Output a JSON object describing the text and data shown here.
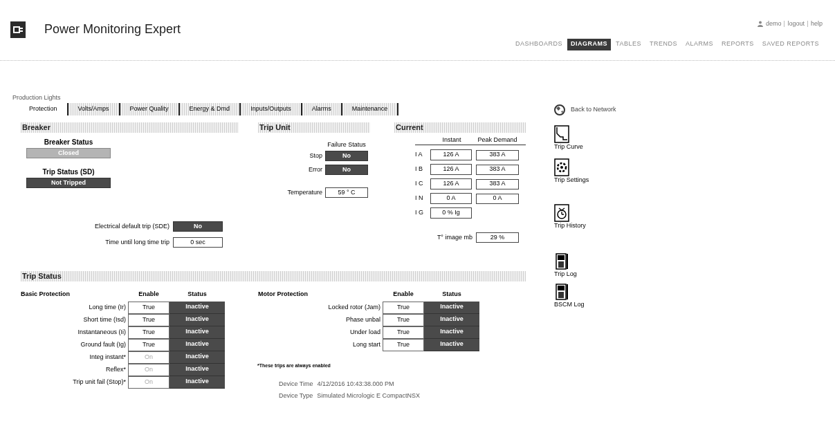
{
  "header": {
    "title": "Power Monitoring Expert",
    "user_links": [
      "demo",
      "logout",
      "help"
    ],
    "nav": [
      {
        "label": "DASHBOARDS",
        "selected": false
      },
      {
        "label": "DIAGRAMS",
        "selected": true
      },
      {
        "label": "TABLES",
        "selected": false
      },
      {
        "label": "TRENDS",
        "selected": false
      },
      {
        "label": "ALARMS",
        "selected": false
      },
      {
        "label": "REPORTS",
        "selected": false
      },
      {
        "label": "SAVED REPORTS",
        "selected": false
      }
    ]
  },
  "breadcrumb": "Production Lights",
  "tabs": [
    {
      "label": "Protection",
      "selected": true
    },
    {
      "label": "Volts/Amps",
      "selected": false
    },
    {
      "label": "Power Quality",
      "selected": false
    },
    {
      "label": "Energy & Dmd",
      "selected": false
    },
    {
      "label": "Inputs/Outputs",
      "selected": false
    },
    {
      "label": "Alarms",
      "selected": false
    },
    {
      "label": "Maintenance",
      "selected": false
    }
  ],
  "back_link": "Back to Network",
  "breaker": {
    "title": "Breaker",
    "status_blocks": [
      {
        "label": "Breaker Status",
        "value": "Closed",
        "kind": "light"
      },
      {
        "label": "Trip Status (SD)",
        "value": "Not Tripped",
        "kind": "dark"
      }
    ],
    "fields": [
      {
        "label": "Electrical default trip (SDE)",
        "value": "No",
        "kind": "dark"
      },
      {
        "label": "Time until long time trip",
        "value": "0 sec",
        "kind": "box"
      }
    ]
  },
  "trip_unit": {
    "title": "Trip Unit",
    "column_header": "Failure Status",
    "rows": [
      {
        "label": "Stop",
        "value": "No"
      },
      {
        "label": "Error",
        "value": "No"
      }
    ],
    "temperature": {
      "label": "Temperature",
      "value": "59 ° C"
    }
  },
  "current": {
    "title": "Current",
    "columns": [
      "Instant",
      "Peak Demand"
    ],
    "rows": [
      {
        "label": "I A",
        "instant": "126 A",
        "peak": "383 A"
      },
      {
        "label": "I B",
        "instant": "126 A",
        "peak": "383 A"
      },
      {
        "label": "I C",
        "instant": "126 A",
        "peak": "383 A"
      },
      {
        "label": "I N",
        "instant": "0 A",
        "peak": "0 A"
      },
      {
        "label": "I G",
        "instant": "0 % Ig"
      }
    ],
    "image": {
      "label": "T° image mb",
      "value": "29 %"
    }
  },
  "trip_status": {
    "title": "Trip Status",
    "groups": [
      {
        "title": "Basic Protection",
        "columns": [
          "Enable",
          "Status"
        ],
        "rows": [
          {
            "label": "Long time (Ir)",
            "enable": "True",
            "disabled": false,
            "status": "Inactive"
          },
          {
            "label": "Short time (Isd)",
            "enable": "True",
            "disabled": false,
            "status": "Inactive"
          },
          {
            "label": "Instantaneous (Ii)",
            "enable": "True",
            "disabled": false,
            "status": "Inactive"
          },
          {
            "label": "Ground fault (Ig)",
            "enable": "True",
            "disabled": false,
            "status": "Inactive"
          },
          {
            "label": "Integ instant*",
            "enable": "On",
            "disabled": true,
            "status": "Inactive"
          },
          {
            "label": "Reflex*",
            "enable": "On",
            "disabled": true,
            "status": "Inactive"
          },
          {
            "label": "Trip unit fail (Stop)*",
            "enable": "On",
            "disabled": true,
            "status": "Inactive"
          }
        ]
      },
      {
        "title": "Motor Protection",
        "columns": [
          "Enable",
          "Status"
        ],
        "rows": [
          {
            "label": "Locked rotor (Jam)",
            "enable": "True",
            "disabled": false,
            "status": "Inactive"
          },
          {
            "label": "Phase unbal",
            "enable": "True",
            "disabled": false,
            "status": "Inactive"
          },
          {
            "label": "Under load",
            "enable": "True",
            "disabled": false,
            "status": "Inactive"
          },
          {
            "label": "Long start",
            "enable": "True",
            "disabled": false,
            "status": "Inactive"
          }
        ]
      }
    ],
    "footnote": "*These trips are always enabled"
  },
  "device_info": [
    {
      "label": "Device Time",
      "value": "4/12/2016 10:43:38.000 PM"
    },
    {
      "label": "Device Type",
      "value": "Simulated Micrologic E CompactNSX"
    }
  ],
  "side_links": [
    {
      "label": "Trip Curve",
      "kind": "curve"
    },
    {
      "label": "Trip Settings",
      "kind": "settings"
    },
    {
      "label": "Trip History",
      "kind": "history"
    },
    {
      "label": "Trip Log",
      "kind": "log"
    },
    {
      "label": "BSCM Log",
      "kind": "log"
    }
  ]
}
